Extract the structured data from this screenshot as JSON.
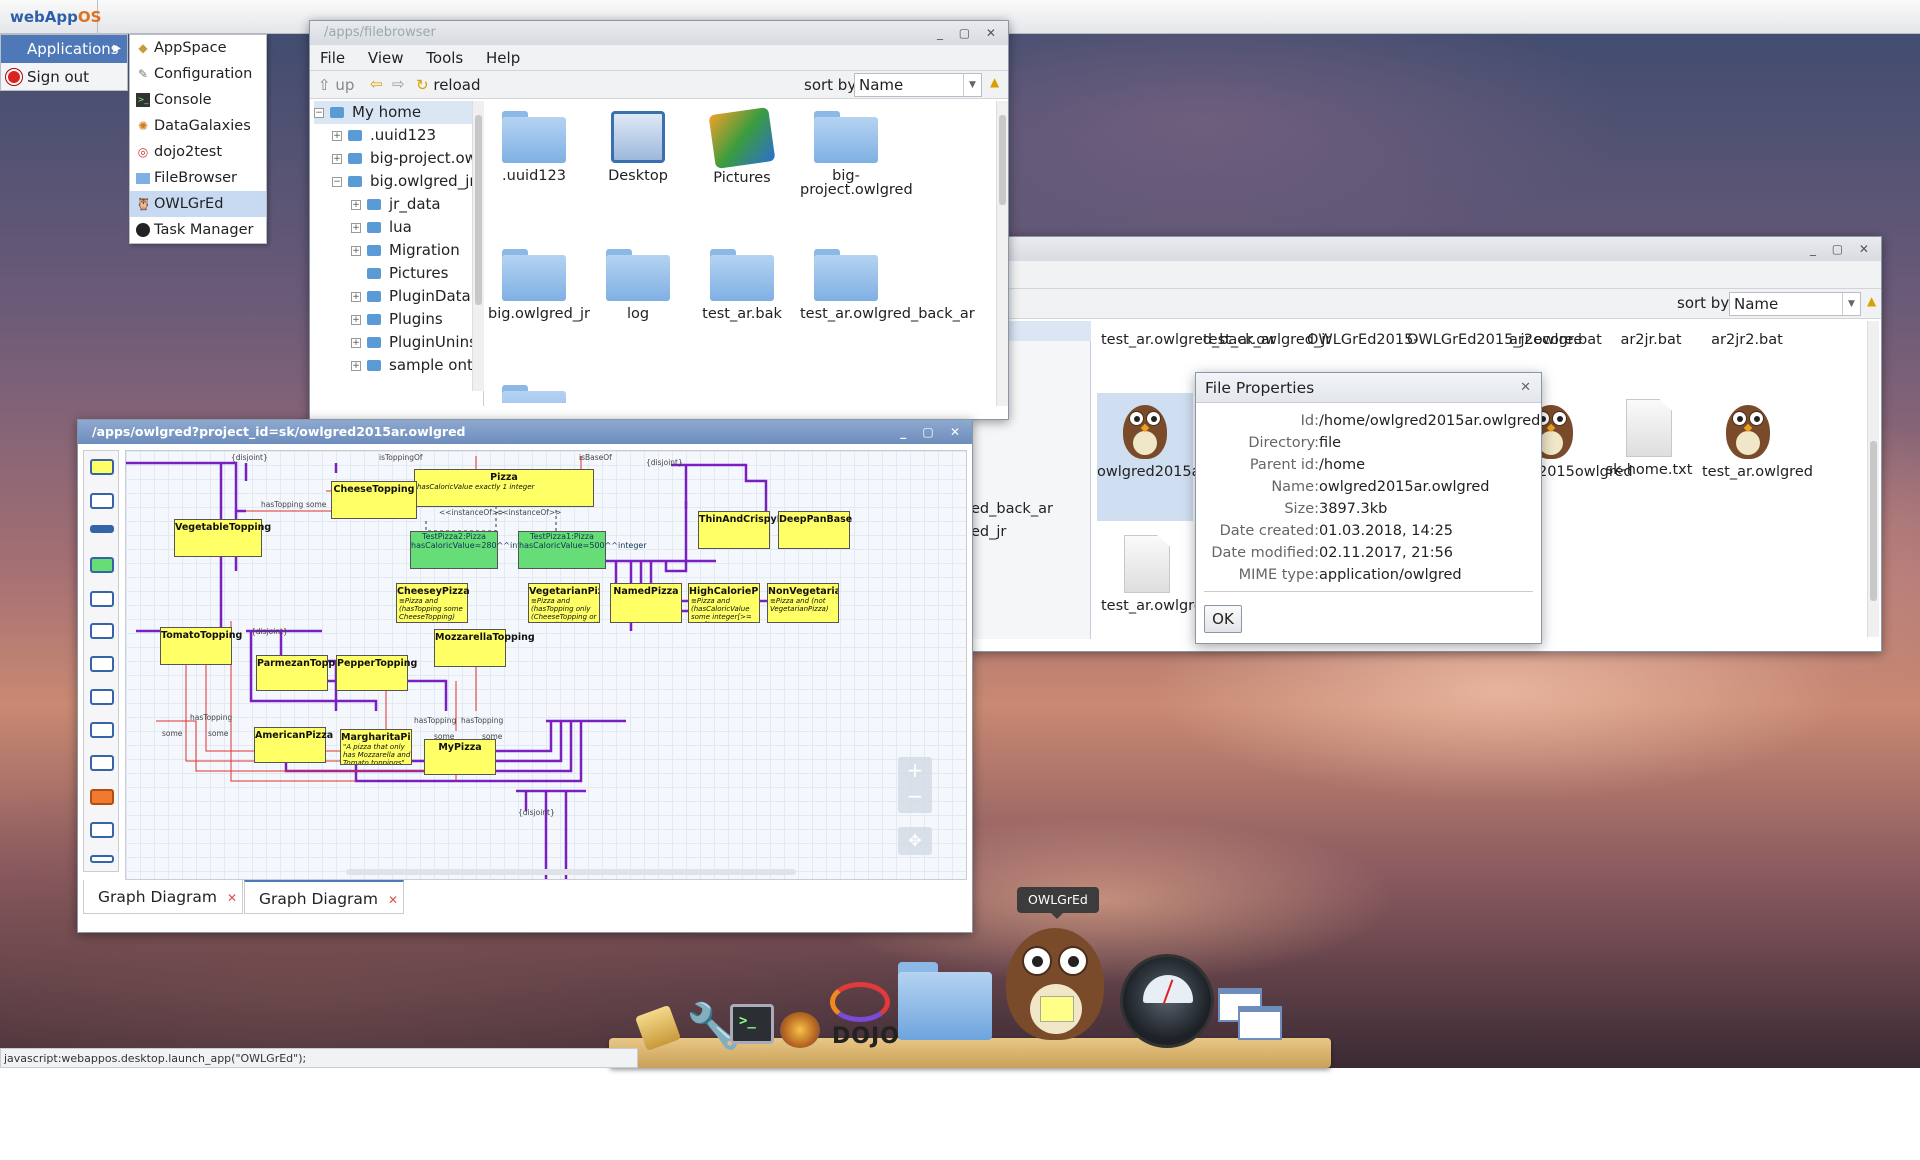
{
  "topbar": {
    "logo_web": "web",
    "logo_app": "App",
    "logo_os": "OS"
  },
  "left_menu": {
    "applications": "Applications",
    "sign_out": "Sign out"
  },
  "submenu": {
    "items": [
      "AppSpace",
      "Configuration",
      "Console",
      "DataGalaxies",
      "dojo2test",
      "FileBrowser",
      "OWLGrEd",
      "Task Manager"
    ],
    "selected": "OWLGrEd"
  },
  "filebrowser": {
    "title": "/apps/filebrowser",
    "menu": [
      "File",
      "View",
      "Tools",
      "Help"
    ],
    "toolbar": {
      "up": "up",
      "reload": "reload",
      "sort_label": "sort by",
      "sort_value": "Name"
    },
    "tree": [
      {
        "label": "My home",
        "expanded": true
      },
      {
        "label": ".uuid123"
      },
      {
        "label": "big-project.ow"
      },
      {
        "label": "big.owlgred_jr",
        "expanded": true
      },
      {
        "label": "jr_data"
      },
      {
        "label": "lua"
      },
      {
        "label": "Migration"
      },
      {
        "label": "Pictures"
      },
      {
        "label": "PluginData"
      },
      {
        "label": "Plugins"
      },
      {
        "label": "PluginUnins"
      },
      {
        "label": "sample onto"
      }
    ],
    "files": [
      ".uuid123",
      "Desktop",
      "Pictures",
      "big-project.owlgred",
      "big.owlgred_jr",
      "log",
      "test_ar.bak",
      "test_ar.owlgred_back_ar"
    ]
  },
  "filebrowser2": {
    "sort_label": "sort by",
    "sort_value": "Name",
    "row1": [
      "test_ar.owlgred_back_ar",
      "test_ar.owlgred_jr",
      "OWLGrEd2015-",
      "OWLGrEd2015_jr.owlgre",
      "ar2ecore.bat",
      "ar2jr.bat",
      "ar2jr2.bat"
    ],
    "row2": [
      "owlgred2015ar.owlgred",
      "gred2015owlgred",
      "sk-home.txt",
      "test_ar.owlgred"
    ],
    "row3": [
      "test_ar.owlgred.bak"
    ],
    "behind": [
      "ed_back_ar",
      "ed_jr"
    ]
  },
  "dialog": {
    "title": "File Properties",
    "props": [
      {
        "k": "Id:",
        "v": "/home/owlgred2015ar.owlgred"
      },
      {
        "k": "Directory:",
        "v": "file"
      },
      {
        "k": "Parent id:",
        "v": "/home"
      },
      {
        "k": "Name:",
        "v": "owlgred2015ar.owlgred"
      },
      {
        "k": "Size:",
        "v": "3897.3kb"
      },
      {
        "k": "Date created:",
        "v": "01.03.2018, 14:25"
      },
      {
        "k": "Date modified:",
        "v": "02.11.2017, 21:56"
      },
      {
        "k": "MIME type:",
        "v": "application/owlgred"
      }
    ],
    "ok": "OK"
  },
  "owlgred": {
    "title": "/apps/owlgred?project_id=sk/owlgred2015ar.owlgred",
    "tabs": [
      "Graph Diagram",
      "Graph Diagram"
    ],
    "classes": {
      "pizza": "Pizza",
      "pizza_sub": "hasCaloricValue exactly 1 integer",
      "cheese": "CheeseTopping",
      "veg": "VegetableTopping",
      "thin": "ThinAndCrispyBase",
      "deep": "DeepPanBase",
      "cheesey": "CheeseyPizza",
      "cheesey_sub": "≡Pizza and (hasTopping some CheeseTopping)",
      "vegp": "VegetarianPizza",
      "vegp_sub": "≡Pizza and (hasTopping only (CheeseTopping or VegetableTopping))",
      "named": "NamedPizza",
      "highcal": "HighCaloriePizza",
      "highcal_sub": "≡Pizza and (hasCaloricValue some integer[>= 400])",
      "nonveg": "NonVegetarianPizza",
      "nonveg_sub": "≡Pizza and (not VegetarianPizza)",
      "tomato": "TomatoTopping",
      "parmezan": "ParmezanTopping",
      "pepper": "PepperTopping",
      "mozz": "MozzarellaTopping",
      "american": "AmericanPizza",
      "margherita": "MargharitaPizza",
      "margherita_sub": "\"A pizza that only has Mozzarella and Tomato toppings\" ⊑hasTopping only (MozzarellaTopping or TomatoTopping)",
      "mypizza": "MyPizza",
      "test2": "TestPizza2:Pizza",
      "test2_sub": "hasCaloricValue=280^^integer",
      "test1": "TestPizza1:Pizza",
      "test1_sub": "hasCaloricValue=500^^integer"
    },
    "labels": {
      "toppingof": "isToppingOf",
      "baseof": "isBaseOf",
      "hastopping": "hasTopping",
      "some": "some",
      "instanceof": "<<instanceOf>>",
      "disjoint": "{disjoint}"
    }
  },
  "dock": {
    "tooltip": "OWLGrEd",
    "dojo": "DOJO"
  },
  "status": {
    "text": "javascript:webappos.desktop.launch_app(\"OWLGrEd\");"
  }
}
